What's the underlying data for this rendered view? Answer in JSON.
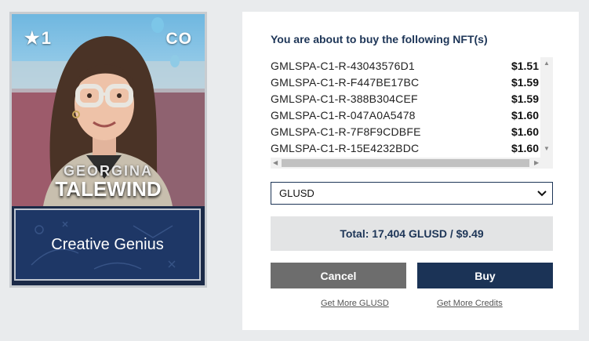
{
  "card": {
    "level": "1",
    "team": "CO",
    "first_name": "GEORGINA",
    "last_name": "TALEWIND",
    "skill": "Creative Genius"
  },
  "purchase": {
    "title": "You are about to buy the following NFT(s)",
    "items": [
      {
        "id": "GMLSPA-C1-R-43043576D1",
        "price": "$1.51"
      },
      {
        "id": "GMLSPA-C1-R-F447BE17BC",
        "price": "$1.59"
      },
      {
        "id": "GMLSPA-C1-R-388B304CEF",
        "price": "$1.59"
      },
      {
        "id": "GMLSPA-C1-R-047A0A5478",
        "price": "$1.60"
      },
      {
        "id": "GMLSPA-C1-R-7F8F9CDBFE",
        "price": "$1.60"
      },
      {
        "id": "GMLSPA-C1-R-15E4232BDC",
        "price": "$1.60"
      }
    ],
    "currency": "GLUSD",
    "total": "Total: 17,404 GLUSD / $9.49",
    "cancel_label": "Cancel",
    "buy_label": "Buy",
    "link_glusd": "Get More GLUSD",
    "link_credits": "Get More Credits"
  },
  "colors": {
    "navy": "#1b3356",
    "cancel_gray": "#6d6d6d",
    "total_bg": "#e3e4e5"
  }
}
